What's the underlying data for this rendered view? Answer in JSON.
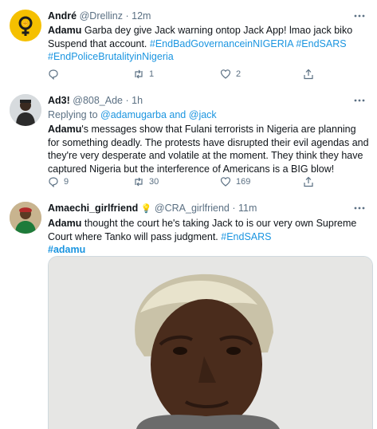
{
  "tweets": [
    {
      "name": "André",
      "handle": "@Drellinz",
      "time": "12m",
      "text_parts": [
        "Adamu",
        " Garba dey give Jack warning ontop Jack App! lmao jack biko Suspend that account. ",
        "#EndBadGovernanceinNIGERIA",
        " ",
        "#EndSARS",
        " ",
        "#EndPoliceBrutalityinNigeria"
      ],
      "replies": "",
      "retweets": "1",
      "likes": "2"
    },
    {
      "name": "Ad3!",
      "handle": "@808_Ade",
      "time": "1h",
      "replying_label": "Replying to",
      "replying_to": "@adamugarba",
      "replying_and": "and",
      "replying_to2": "@jack",
      "text_parts": [
        "Adamu",
        "'s messages show that Fulani terrorists in Nigeria are planning for something deadly. The protests have disrupted their evil agendas and they're very desperate and volatile at the moment. They think they have captured Nigeria but the interference of Americans is a BIG blow!"
      ],
      "replies": "9",
      "retweets": "30",
      "likes": "169"
    },
    {
      "name": "Amaechi_girlfriend",
      "emoji": "💡",
      "handle": "@CRA_girlfriend",
      "time": "11m",
      "text_parts": [
        "Adamu",
        " thought the court he's taking Jack to is our very own Supreme Court where Tanko will pass judgment.  ",
        "#EndSARS",
        "#adamu"
      ]
    }
  ],
  "separator_dot": "·",
  "colors": {
    "link": "#1b95e0",
    "muted": "#5b7083",
    "border": "#e1e8ed"
  },
  "icons": [
    "reply-icon",
    "retweet-icon",
    "like-icon",
    "share-icon",
    "more-icon"
  ]
}
